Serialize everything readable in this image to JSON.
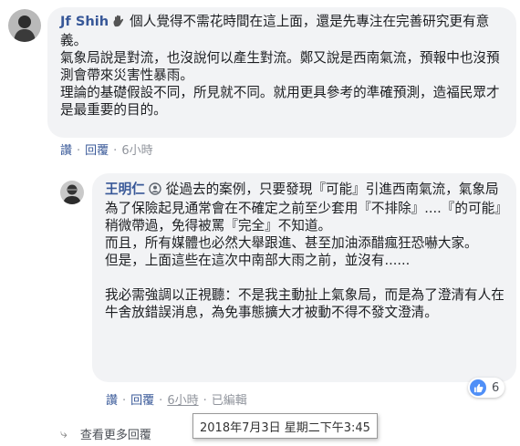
{
  "comment1": {
    "author": "Jf Shih",
    "paragraphs": [
      "個人覺得不需花時間在這上面，還是先專注在完善研究更有意義。",
      "氣象局說是對流，也沒說何以產生對流。鄭又說是西南氣流，預報中也沒預測會帶來災害性暴雨。",
      "理論的基礎假設不同，所見就不同。就用更具參考的準確預測，造福民眾才是最重要的目的。"
    ],
    "actions": {
      "like": "讚",
      "reply": "回覆",
      "time": "6小時"
    }
  },
  "comment2": {
    "author": "王明仁",
    "paragraphs": [
      "從過去的案例，只要發現『可能』引進西南氣流，氣象局為了保險起見通常會在不確定之前至少套用『不排除』....『的可能』稍微帶過，免得被罵『完全』不知道。",
      "而且，所有媒體也必然大舉跟進、甚至加油添醋瘋狂恐嚇大家。",
      "但是，上面這些在這次中南部大雨之前，並沒有......",
      "我必需強調以正視聽：不是我主動扯上氣象局，而是為了澄清有人在牛舍放錯誤消息，為免事態擴大才被動不得不發文澄清。"
    ],
    "actions": {
      "like": "讚",
      "reply": "回覆",
      "time": "6小時",
      "edited": "已編輯"
    },
    "reaction_count": "6"
  },
  "tooltip": "2018年7月3日 星期二下午3:45",
  "view_more": "查看更多回覆",
  "colors": {
    "name_link": "#385898",
    "bubble": "#f2f3f5",
    "like_blue": "#4f8ff7"
  },
  "icons": [
    "wave-hand-icon",
    "profile-badge-icon",
    "like-reaction-icon",
    "reply-arrow-icon"
  ]
}
